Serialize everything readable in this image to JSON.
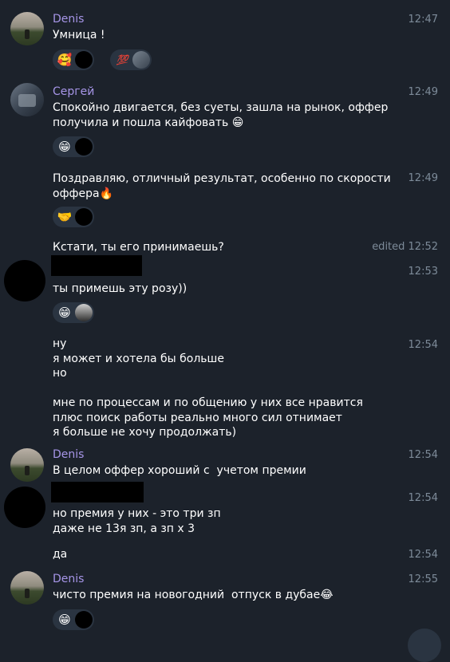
{
  "messages": {
    "m1": {
      "name": "Denis",
      "time": "12:47",
      "text": "Умница !"
    },
    "m1_reactions": [
      {
        "emoji": "🥰"
      },
      {
        "emoji": "💯"
      }
    ],
    "m2": {
      "name": "Сергей",
      "time": "12:49",
      "text": "Спокойно двигается, без суеты, зашла на рынок, оффер\nполучила и пошла кайфовать",
      "emoji": "😁"
    },
    "m2_reactions": [
      {
        "emoji": "😁"
      }
    ],
    "m3": {
      "time": "12:49",
      "text": "Поздравляю, отличный результат, особенно по скорости\nоффера",
      "emoji": "🔥"
    },
    "m3_reactions": [
      {
        "emoji": "🤝"
      }
    ],
    "m4": {
      "time": "edited 12:52",
      "text": "Кстати, ты его принимаешь?"
    },
    "m5": {
      "time": "12:53",
      "text": "ты примешь эту розу))"
    },
    "m5_reactions": [
      {
        "emoji": "😁"
      }
    ],
    "m6": {
      "time": "12:54",
      "text": "ну\nя может и хотела бы больше\nно\n\nмне по процессам и по общению у них все нравится\nплюс поиск работы реально много сил отнимает\nя больше не хочу продолжать)"
    },
    "m7": {
      "name": "Denis",
      "time": "12:54",
      "text": "В целом оффер хороший с  учетом премии"
    },
    "m8": {
      "time": "12:54",
      "text": "но премия у них - это три зп\nдаже не 13я зп, а зп х 3"
    },
    "m9": {
      "time": "12:54",
      "text": "да"
    },
    "m10": {
      "name": "Denis",
      "time": "12:55",
      "text": "чисто премия на новогодний  отпуск в дубае",
      "emoji": "😂"
    },
    "m10_reactions": [
      {
        "emoji": "😁"
      }
    ]
  },
  "colors": {
    "background": "#1c222b",
    "name": "#a695e7",
    "time": "#7d8b99",
    "reaction_bg": "#2a3441"
  }
}
